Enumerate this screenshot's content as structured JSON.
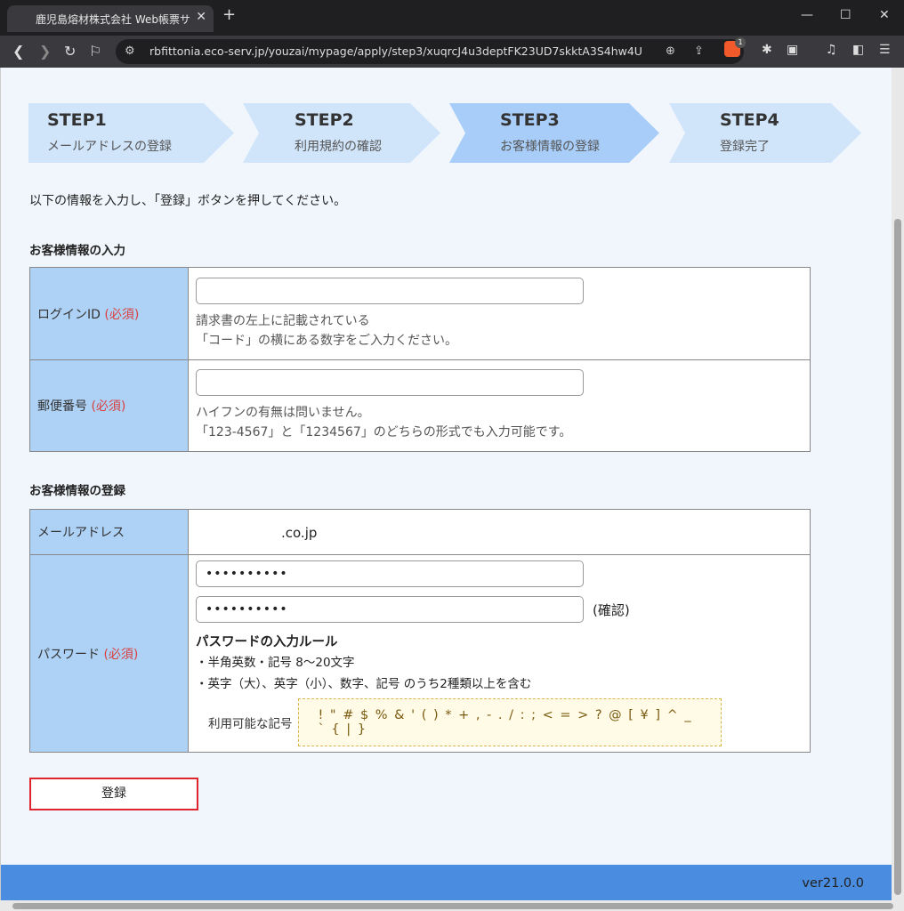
{
  "browser": {
    "tab_title": "鹿児島熔材株式会社 Web帳票サ",
    "url": "rbfittonia.eco-serv.jp/youzai/mypage/apply/step3/xuqrcJ4u3deptFK23UD7skktA3S4hw4U",
    "shield_badge": "1"
  },
  "steps": [
    {
      "title": "STEP1",
      "sub": "メールアドレスの登録"
    },
    {
      "title": "STEP2",
      "sub": "利用規約の確認"
    },
    {
      "title": "STEP3",
      "sub": "お客様情報の登録"
    },
    {
      "title": "STEP4",
      "sub": "登録完了"
    }
  ],
  "active_step": 3,
  "intro": "以下の情報を入力し、「登録」ボタンを押してください。",
  "section1": {
    "heading": "お客様情報の入力",
    "login_id": {
      "label": "ログインID",
      "required": "(必須)",
      "value": "",
      "help1": "請求書の左上に記載されている",
      "help2": "「コード」の横にある数字をご入力ください。"
    },
    "postal": {
      "label": "郵便番号",
      "required": "(必須)",
      "value": "",
      "help1": "ハイフンの有無は問いません。",
      "help2": "「123-4567」と「1234567」のどちらの形式でも入力可能です。"
    }
  },
  "section2": {
    "heading": "お客様情報の登録",
    "email": {
      "label": "メールアドレス",
      "value": ".co.jp"
    },
    "password": {
      "label": "パスワード",
      "required": "(必須)",
      "value": "••••••••••",
      "confirm_value": "••••••••••",
      "confirm_label": "(確認)",
      "rule_heading": "パスワードの入力ルール",
      "rule1": "・半角英数・記号 8～20文字",
      "rule2": "・英字（大）、英字（小）、数字、記号 のうち2種類以上を含む",
      "symbols_label": "利用可能な記号",
      "symbols": "! \" # $ % & ' ( ) * + , - . / : ; < = > ? @ [ ¥ ] ^ _ ` { | }"
    }
  },
  "submit_label": "登録",
  "version": "ver21.0.0",
  "colors": {
    "accent_border": "#e0252d",
    "step_active": "#a8cdf8",
    "step_inactive": "#d0e4fa",
    "label_bg": "#aed2f6",
    "footer": "#4a8de0"
  }
}
